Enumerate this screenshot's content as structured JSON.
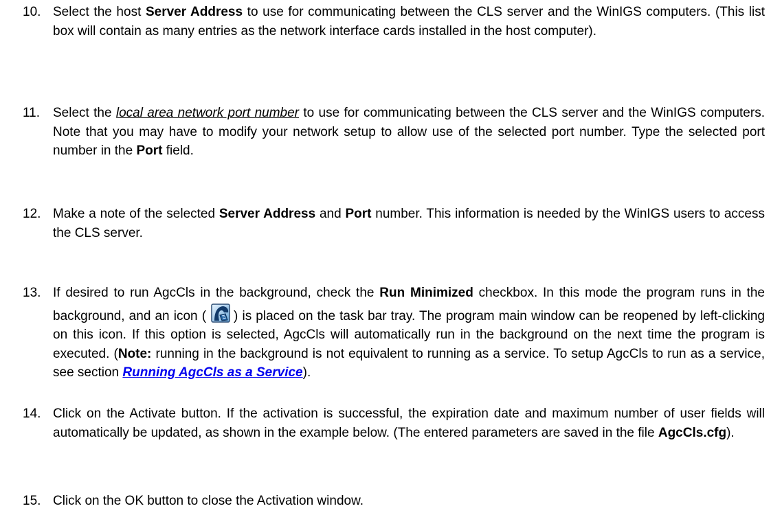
{
  "steps": [
    {
      "num": "10.",
      "p": [
        "Select the host ",
        "Server Address",
        " to use for communicating between the CLS server and the WinIGS computers.  (This list box will contain as many entries as the network interface cards installed in the host computer)."
      ]
    },
    {
      "num": "11.",
      "p": [
        "Select the ",
        "local area network port number",
        " to use for communicating between the CLS server and the WinIGS computers.  Note that you may have to modify your network setup to allow use of the selected port number.  Type the selected port number in the ",
        "Port",
        " field."
      ]
    },
    {
      "num": "12.",
      "p": [
        "Make a note of the selected ",
        "Server Address",
        " and ",
        "Port",
        " number.   This information is needed by the WinIGS users to access the CLS server."
      ]
    },
    {
      "num": "13.",
      "p": [
        "If desired to run AgcCls in the background, check the ",
        "Run Minimized",
        " checkbox.  In this mode the program runs in the background, and an icon (",
        ") is placed on the task bar tray.  The program main window can be reopened by left-clicking on this icon. If this option is selected, AgcCls will automatically run in the background on the next time the program is executed. (",
        "Note:",
        " running in the background is not equivalent to running as a service.   To setup AgcCls to run as a service, see section ",
        "Running AgcCls as a Service",
        ")."
      ]
    },
    {
      "num": "14.",
      "p": [
        "Click on the Activate button. If the activation is successful, the expiration date and maximum number of user fields will automatically be updated, as shown in the example below. (The entered parameters are saved in the file ",
        "AgcCls.cfg",
        ")."
      ]
    },
    {
      "num": "15.",
      "p": [
        "Click on the OK button to close the Activation window."
      ]
    }
  ],
  "icons": {
    "tray_icon": "agccls-tray-icon"
  }
}
